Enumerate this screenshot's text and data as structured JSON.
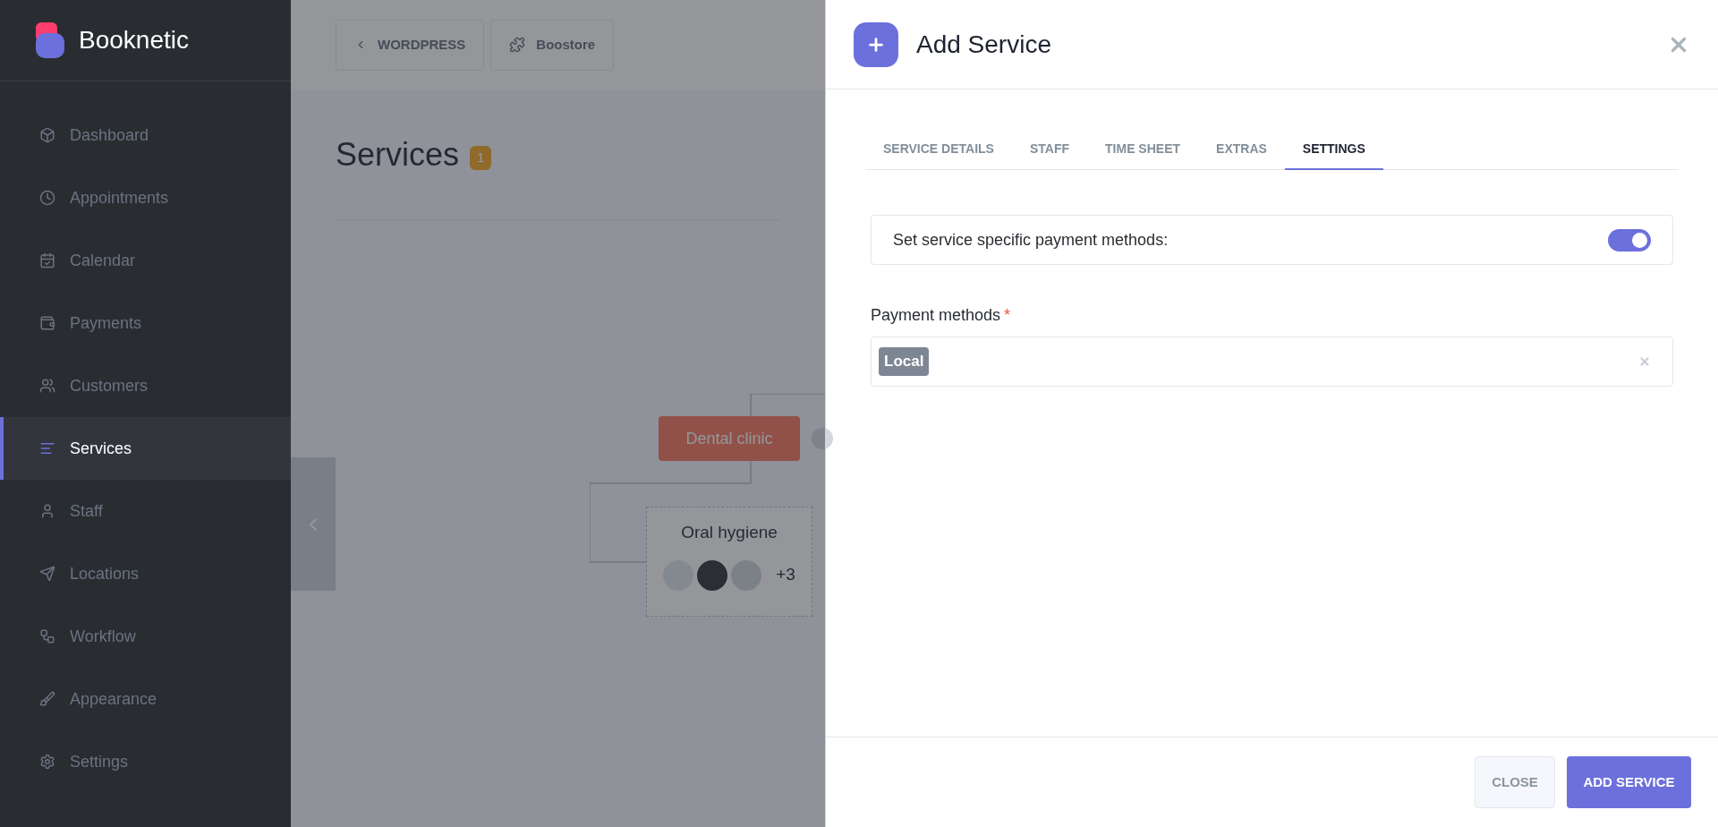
{
  "sidebar": {
    "brand": "Booknetic",
    "items": [
      {
        "label": "Dashboard",
        "selected": false
      },
      {
        "label": "Appointments",
        "selected": false
      },
      {
        "label": "Calendar",
        "selected": false
      },
      {
        "label": "Payments",
        "selected": false
      },
      {
        "label": "Customers",
        "selected": false
      },
      {
        "label": "Services",
        "selected": true
      },
      {
        "label": "Staff",
        "selected": false
      },
      {
        "label": "Locations",
        "selected": false
      },
      {
        "label": "Workflow",
        "selected": false
      },
      {
        "label": "Appearance",
        "selected": false
      },
      {
        "label": "Settings",
        "selected": false
      }
    ]
  },
  "topbar": {
    "back_button": "WORDPRESS",
    "store_button": "Boostore"
  },
  "page": {
    "title": "Services",
    "count": "1",
    "category": "Dental clinic",
    "service": {
      "name": "Oral hygiene",
      "more": "+3"
    }
  },
  "modal": {
    "title": "Add Service",
    "tabs": [
      {
        "label": "SERVICE DETAILS",
        "selected": false
      },
      {
        "label": "STAFF",
        "selected": false
      },
      {
        "label": "TIME SHEET",
        "selected": false
      },
      {
        "label": "EXTRAS",
        "selected": false
      },
      {
        "label": "SETTINGS",
        "selected": true
      }
    ],
    "toggle": {
      "label": "Set service specific payment methods:",
      "on": true
    },
    "payment_methods": {
      "label": "Payment methods",
      "required_mark": "*",
      "tags": [
        "Local"
      ]
    },
    "buttons": {
      "close": "CLOSE",
      "submit": "ADD SERVICE"
    }
  }
}
